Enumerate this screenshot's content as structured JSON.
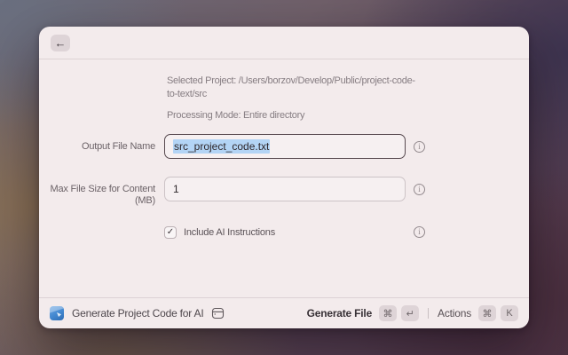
{
  "header": {
    "back_icon": "←"
  },
  "info": {
    "selected_project": "Selected Project: /Users/borzov/Develop/Public/project-code-to-text/src",
    "processing_mode": "Processing Mode: Entire directory"
  },
  "form": {
    "output_file": {
      "label": "Output File Name",
      "value": "src_project_code.txt",
      "selected": true
    },
    "max_file_size": {
      "label": "Max File Size for Content (MB)",
      "value": "1"
    },
    "include_ai": {
      "label": "Include AI Instructions",
      "checked": true,
      "check_glyph": "✓"
    }
  },
  "icons": {
    "info_glyph": "i"
  },
  "footer": {
    "command_title": "Generate Project Code for AI",
    "primary_action": "Generate File",
    "primary_keys": [
      "⌘",
      "↵"
    ],
    "actions_label": "Actions",
    "actions_keys": [
      "⌘",
      "K"
    ]
  },
  "colors": {
    "selection_highlight": "#b3d4f5",
    "extension_icon_blue": "#4287cf",
    "window_background": "#f3ebec"
  }
}
